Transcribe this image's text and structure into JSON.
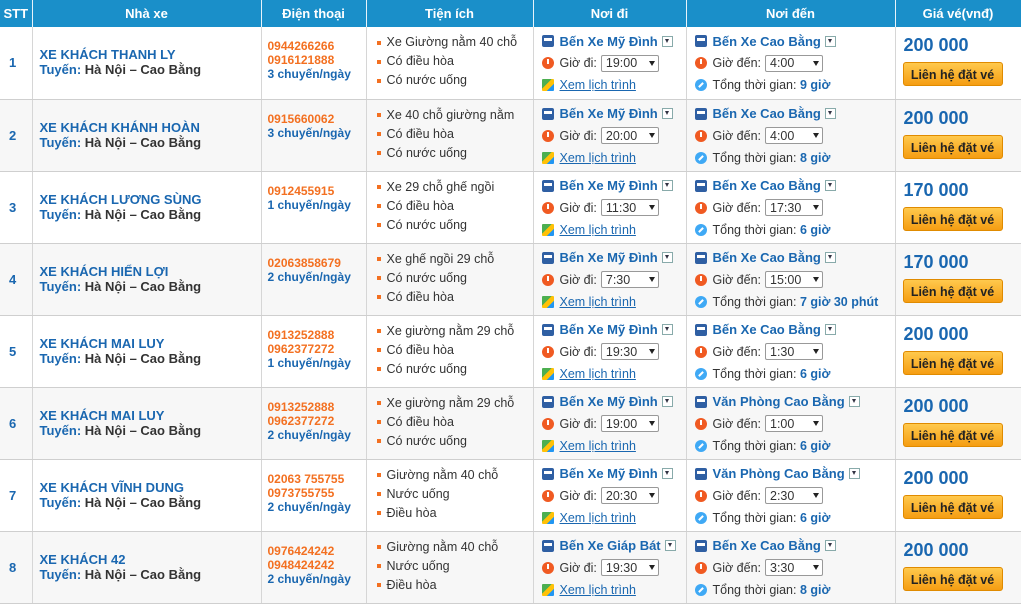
{
  "headers": {
    "stt": "STT",
    "bus": "Nhà xe",
    "phone": "Điện thoại",
    "amenities": "Tiện ích",
    "from": "Nơi đi",
    "to": "Nơi đến",
    "price": "Giá vé(vnđ)"
  },
  "labels": {
    "route_prefix": "Tuyến:",
    "depart": "Giờ đi:",
    "arrive": "Giờ đến:",
    "schedule": "Xem lịch trình",
    "total": "Tổng thời gian:",
    "book": "Liên hệ đặt vé"
  },
  "rows": [
    {
      "stt": "1",
      "name": "XE KHÁCH THANH LY",
      "route": "Hà Nội – Cao Bằng",
      "phones": [
        "0944266266",
        "0916121888"
      ],
      "trips": "3 chuyến/ngày",
      "amenities": [
        "Xe Giường nằm 40 chỗ",
        "Có điều hòa",
        "Có nước uống"
      ],
      "from": "Bến Xe Mỹ Đình",
      "depart": "19:00",
      "to": "Bến Xe Cao Bằng",
      "arrive": "4:00",
      "duration": "9 giờ",
      "price": "200 000"
    },
    {
      "stt": "2",
      "name": "XE KHÁCH KHÁNH HOÀN",
      "route": "Hà Nội – Cao Bằng",
      "phones": [
        "0915660062"
      ],
      "trips": "3 chuyến/ngày",
      "amenities": [
        "Xe 40 chỗ giường nằm",
        "Có điều hòa",
        "Có nước uống"
      ],
      "from": "Bến Xe Mỹ Đình",
      "depart": "20:00",
      "to": "Bến Xe Cao Bằng",
      "arrive": "4:00",
      "duration": "8 giờ",
      "price": "200 000"
    },
    {
      "stt": "3",
      "name": "XE KHÁCH LƯƠNG SÙNG",
      "route": "Hà Nội – Cao Bằng",
      "phones": [
        "0912455915"
      ],
      "trips": "1 chuyến/ngày",
      "amenities": [
        "Xe 29 chỗ ghế ngồi",
        "Có điều hòa",
        "Có nước uống"
      ],
      "from": "Bến Xe Mỹ Đình",
      "depart": "11:30",
      "to": "Bến Xe Cao Bằng",
      "arrive": "17:30",
      "duration": "6 giờ",
      "price": "170 000"
    },
    {
      "stt": "4",
      "name": "XE KHÁCH HIỂN LỢI",
      "route": "Hà Nội – Cao Bằng",
      "phones": [
        "02063858679"
      ],
      "trips": "2 chuyến/ngày",
      "amenities": [
        "Xe ghế ngồi 29 chỗ",
        "Có nước uống",
        "Có điều hòa"
      ],
      "from": "Bến Xe Mỹ Đình",
      "depart": "7:30",
      "to": "Bến Xe Cao Bằng",
      "arrive": "15:00",
      "duration": "7 giờ 30 phút",
      "price": "170 000"
    },
    {
      "stt": "5",
      "name": "XE KHÁCH MAI LUY",
      "route": "Hà Nội – Cao Bằng",
      "phones": [
        "0913252888",
        "0962377272"
      ],
      "trips": "1 chuyến/ngày",
      "amenities": [
        "Xe giường nằm 29 chỗ",
        "Có điều hòa",
        "Có nước uống"
      ],
      "from": "Bến Xe Mỹ Đình",
      "depart": "19:30",
      "to": "Bến Xe Cao Bằng",
      "arrive": "1:30",
      "duration": "6 giờ",
      "price": "200 000"
    },
    {
      "stt": "6",
      "name": "XE KHÁCH MAI LUY",
      "route": "Hà Nội – Cao Bằng",
      "phones": [
        "0913252888",
        "0962377272"
      ],
      "trips": "2 chuyến/ngày",
      "amenities": [
        "Xe giường nằm 29 chỗ",
        "Có điều hòa",
        "Có nước uống"
      ],
      "from": "Bến Xe Mỹ Đình",
      "depart": "19:00",
      "to": "Văn Phòng Cao Bằng",
      "arrive": "1:00",
      "duration": "6 giờ",
      "price": "200 000"
    },
    {
      "stt": "7",
      "name": "XE KHÁCH VĨNH DUNG",
      "route": "Hà Nội – Cao Bằng",
      "phones": [
        "02063 755755",
        "0973755755"
      ],
      "trips": "2 chuyến/ngày",
      "amenities": [
        "Giường nằm 40 chỗ",
        "Nước uống",
        "Điều hòa"
      ],
      "from": "Bến Xe Mỹ Đình",
      "depart": "20:30",
      "to": "Văn Phòng Cao Bằng",
      "arrive": "2:30",
      "duration": "6 giờ",
      "price": "200 000"
    },
    {
      "stt": "8",
      "name": "XE KHÁCH 42",
      "route": "Hà Nội – Cao Bằng",
      "phones": [
        "0976424242",
        "0948424242"
      ],
      "trips": "2 chuyến/ngày",
      "amenities": [
        "Giường nằm 40 chỗ",
        "Nước uống",
        "Điều hòa"
      ],
      "from": "Bến Xe Giáp Bát",
      "depart": "19:30",
      "to": "Bến Xe Cao Bằng",
      "arrive": "3:30",
      "duration": "8 giờ",
      "price": "200 000"
    }
  ]
}
